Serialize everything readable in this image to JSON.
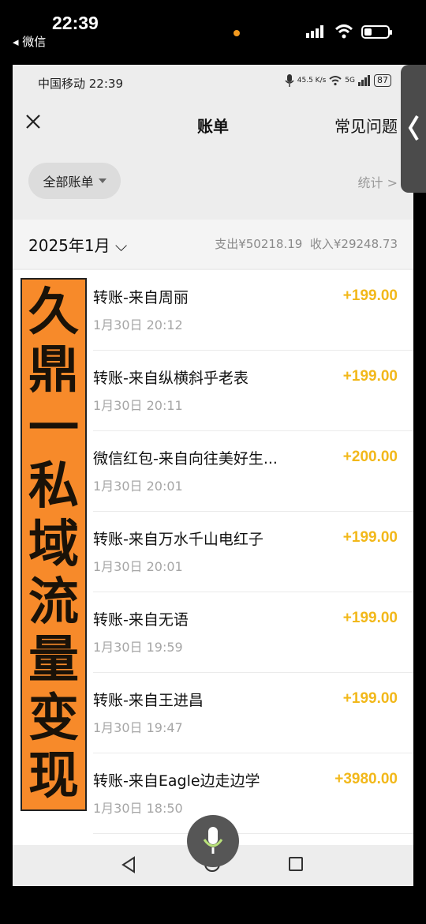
{
  "outer_status": {
    "time": "22:39",
    "back_app": "◂ 微信",
    "battery_level": 0.25
  },
  "inner_status": {
    "carrier_time": "中国移动 22:39",
    "speed": "45.5 K/s",
    "network": "5G",
    "battery": "87"
  },
  "nav": {
    "title": "账单",
    "faq": "常见问题"
  },
  "filter": {
    "label": "全部账单",
    "stats": "统计 >"
  },
  "month_bar": {
    "month": "2025年1月 ⌵",
    "expense": "支出¥50218.19",
    "income": "收入¥29248.73"
  },
  "transactions": [
    {
      "title": "转账-来自周丽",
      "time": "1月30日 20:12",
      "amount": "+199.00"
    },
    {
      "title": "转账-来自纵横斜乎老表",
      "time": "1月30日 20:11",
      "amount": "+199.00"
    },
    {
      "title": "微信红包-来自向往美好生...",
      "time": "1月30日 20:01",
      "amount": "+200.00"
    },
    {
      "title": "转账-来自万水千山电红子",
      "time": "1月30日 20:01",
      "amount": "+199.00"
    },
    {
      "title": "转账-来自无语",
      "time": "1月30日 19:59",
      "amount": "+199.00"
    },
    {
      "title": "转账-来自王进昌",
      "time": "1月30日 19:47",
      "amount": "+199.00"
    },
    {
      "title": "转账-来自Eagle边走边学",
      "time": "1月30日 18:50",
      "amount": "+3980.00"
    }
  ],
  "banner": {
    "chars": [
      "久",
      "鼎",
      "一",
      "私",
      "域",
      "流",
      "量",
      "变",
      "现"
    ]
  },
  "colors": {
    "amount": "#f2b81a",
    "banner": "#f78a2a"
  }
}
